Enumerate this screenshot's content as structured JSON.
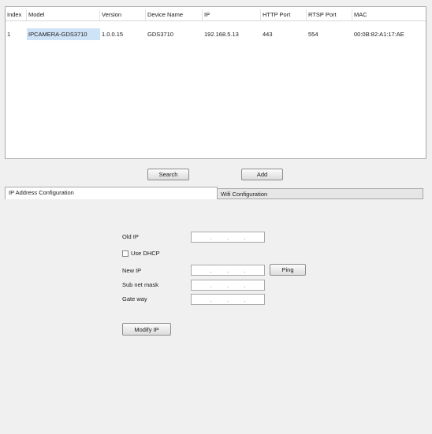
{
  "device_table": {
    "headers": [
      "Index",
      "Model",
      "Version",
      "Device Name",
      "IP",
      "HTTP Port",
      "RTSP Port",
      "MAC"
    ],
    "rows": [
      [
        "1",
        "IPCAMERA-GDS3710",
        "1.0.0.15",
        "GDS3710",
        "192.168.5.13",
        "443",
        "554",
        "00:0B:82:A1:17:AE"
      ]
    ]
  },
  "buttons": {
    "search": "Search",
    "add": "Add",
    "ping": "Ping",
    "modify_ip": "Modify IP"
  },
  "tabs": [
    {
      "label": "IP Address Configuration",
      "active": true
    },
    {
      "label": "Wifi Configuration",
      "active": false
    }
  ],
  "ip_config": {
    "old_ip_label": "Old IP",
    "use_dhcp_label": "Use DHCP",
    "use_dhcp_checked": false,
    "new_ip_label": "New IP",
    "subnet_mask_label": "Sub net mask",
    "gateway_label": "Gate way",
    "ip_separator": "."
  }
}
